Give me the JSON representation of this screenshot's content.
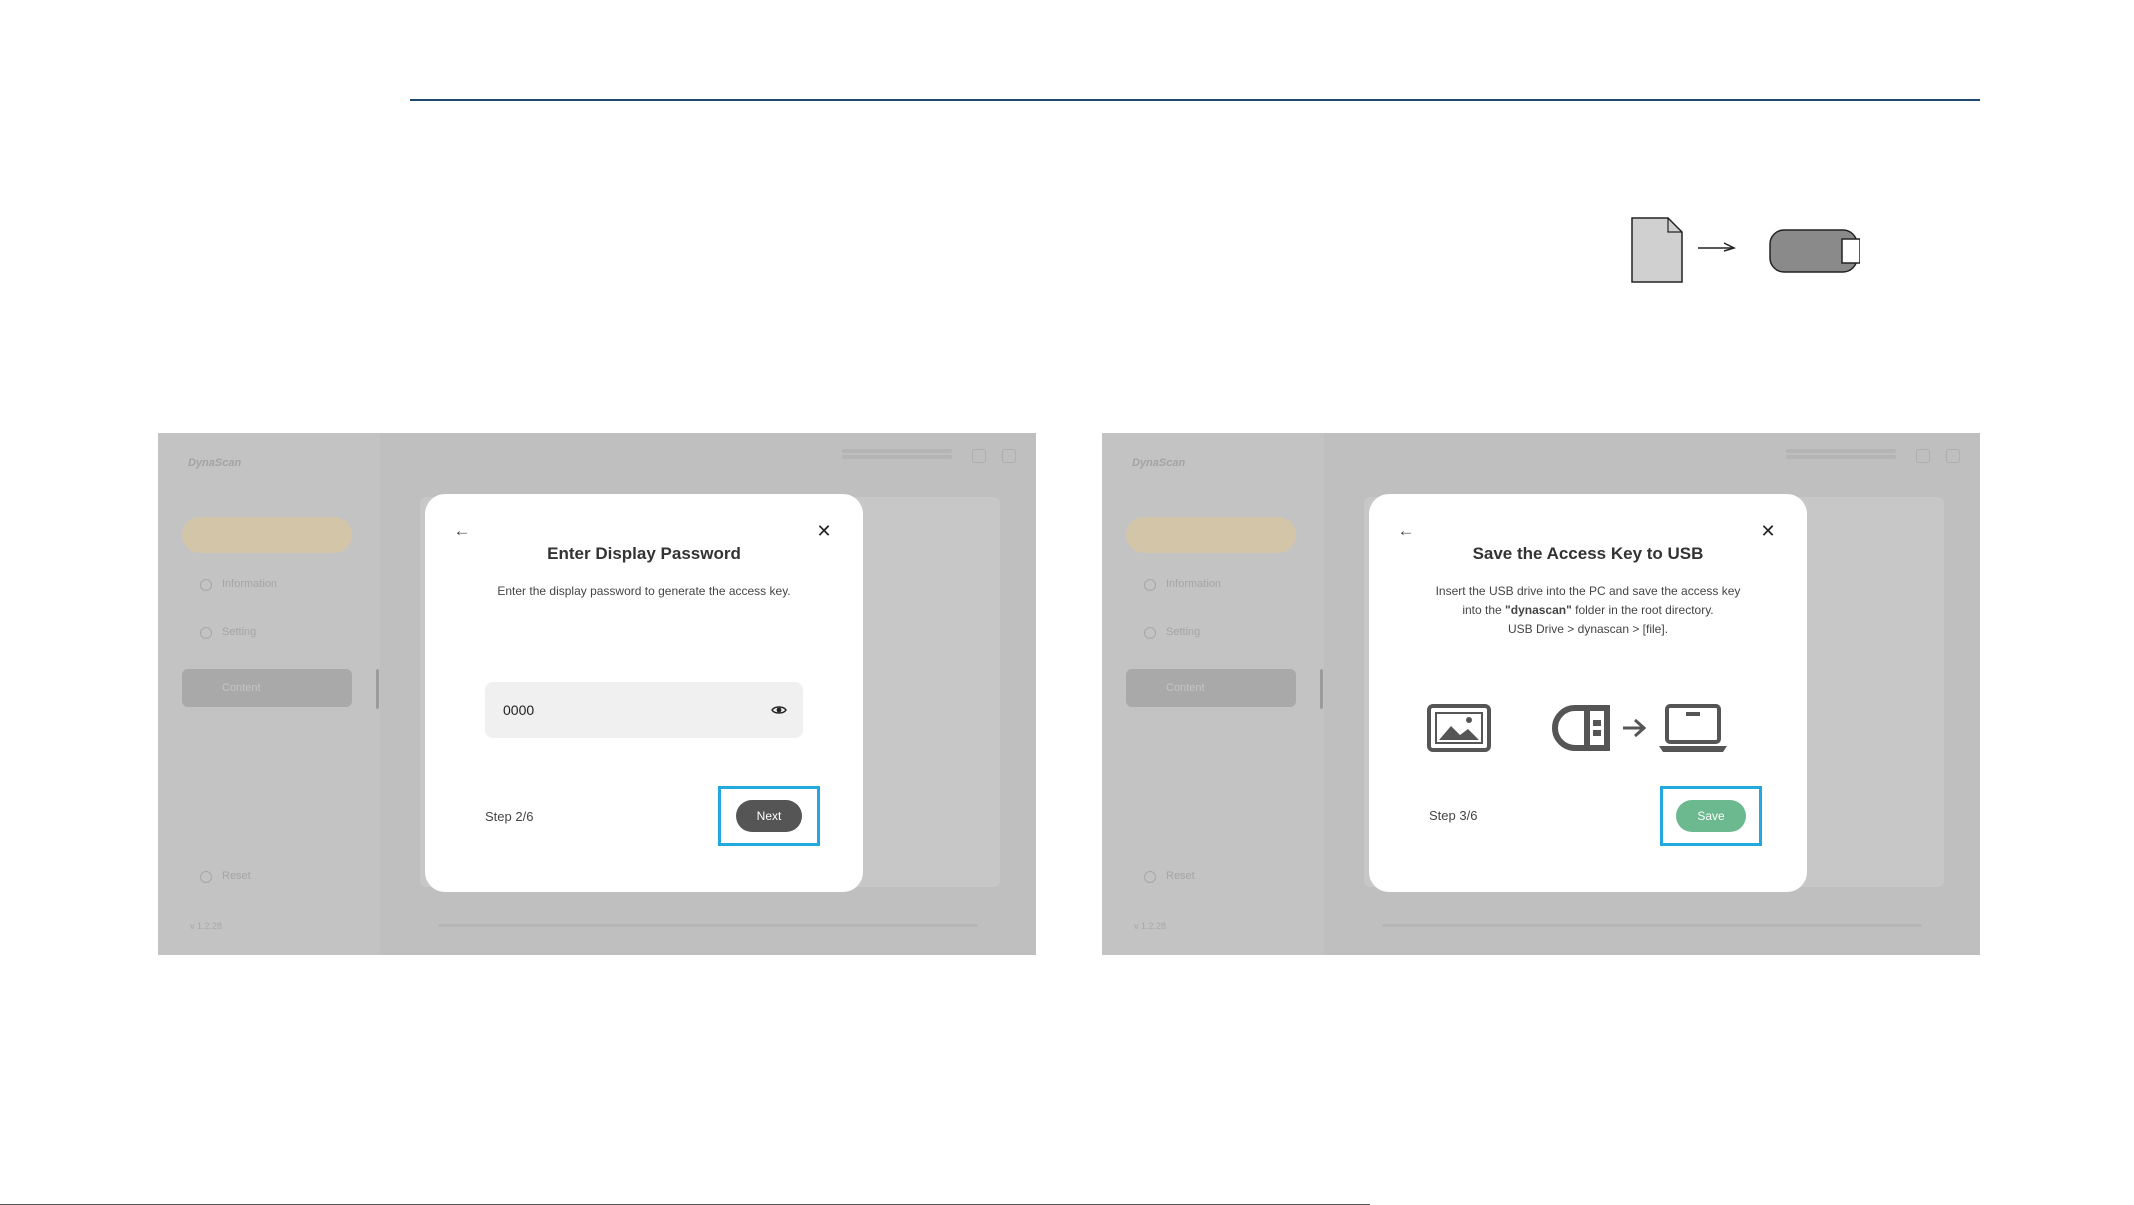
{
  "left_screenshot": {
    "background": {
      "logo": "DynaScan",
      "version": "v 1.2.28",
      "sidebar_items": [
        "Information",
        "Setting",
        "Content"
      ],
      "reset_label": "Reset"
    },
    "modal": {
      "title": "Enter Display Password",
      "description": "Enter the display password to generate the access key.",
      "password_value": "0000",
      "step": "Step 2/6",
      "next_label": "Next"
    }
  },
  "right_screenshot": {
    "background": {
      "logo": "DynaScan",
      "version": "v 1.2.28",
      "sidebar_items": [
        "Information",
        "Setting",
        "Content"
      ],
      "reset_label": "Reset"
    },
    "modal": {
      "title": "Save the Access Key to USB",
      "description_part1": "Insert the USB drive into the PC and save the access key into the ",
      "description_bold": "\"dynascan\"",
      "description_part2": " folder in the root directory.",
      "path_line": "USB Drive > dynascan > [file].",
      "step": "Step 3/6",
      "save_label": "Save"
    }
  },
  "colors": {
    "rule": "#1f4a6e",
    "highlight": "#22a9e0",
    "save_button": "#6cb98f",
    "next_button": "#555555",
    "overlay": "#bfbfbf"
  }
}
